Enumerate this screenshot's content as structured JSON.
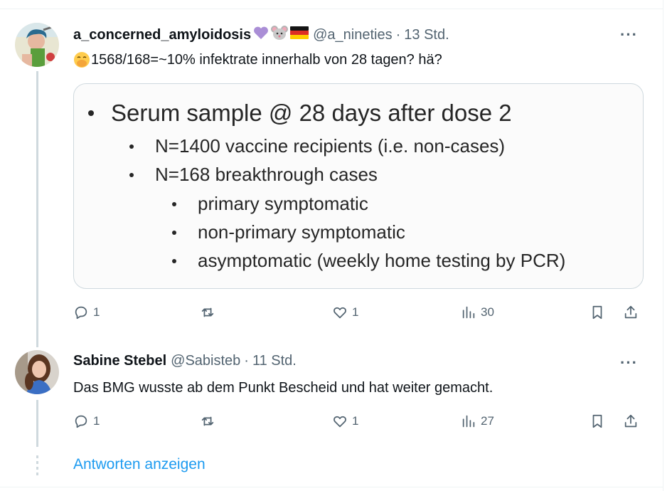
{
  "tweets": [
    {
      "display_name": "a_concerned_amyloidosis",
      "badges": [
        "purple-heart",
        "mouse",
        "german-flag"
      ],
      "handle": "@a_nineties",
      "separator": "·",
      "time": "13 Std.",
      "text_emoji": "hand-over-mouth",
      "text": "1568/168=~10% infektrate innerhalb von 28 tagen? hä?",
      "media": {
        "line1": "Serum sample @ 28 days after dose 2",
        "sub": [
          "N=1400 vaccine recipients (i.e. non-cases)",
          "N=168 breakthrough cases"
        ],
        "subsub": [
          "primary symptomatic",
          "non-primary symptomatic",
          "asymptomatic (weekly home testing by PCR)"
        ]
      },
      "reply_count": "1",
      "like_count": "1",
      "view_count": "30",
      "more": "···"
    },
    {
      "display_name": "Sabine Stebel",
      "handle": "@Sabisteb",
      "separator": "·",
      "time": "11 Std.",
      "text": "Das BMG wusste ab dem Punkt Bescheid und hat weiter gemacht.",
      "reply_count": "1",
      "like_count": "1",
      "view_count": "27",
      "more": "···"
    }
  ],
  "show_replies_label": "Antworten anzeigen",
  "colors": {
    "accent": "#1d9bf0",
    "muted": "#536471",
    "line": "#cfd9de"
  }
}
